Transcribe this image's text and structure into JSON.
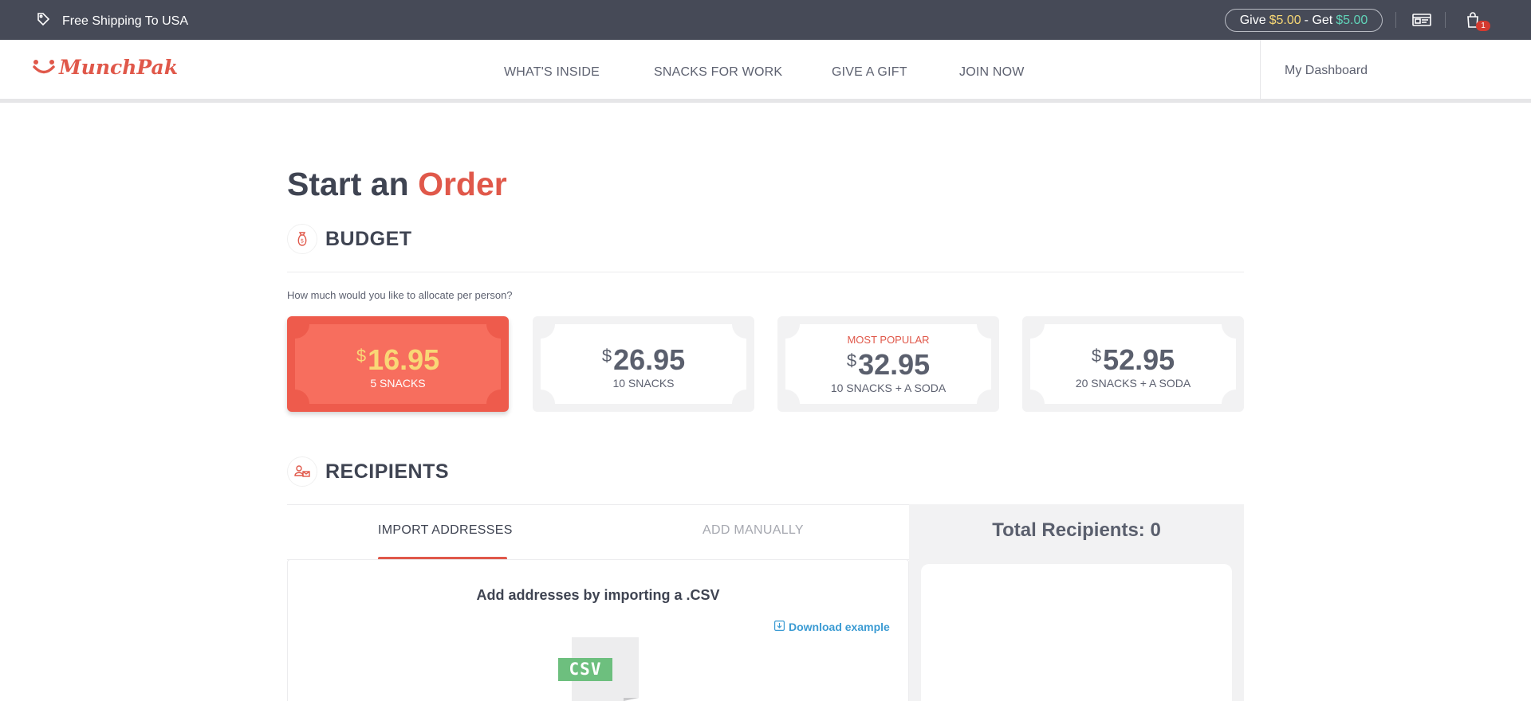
{
  "topbar": {
    "shipping_text": "Free Shipping To USA",
    "give_prefix": "Give",
    "give_amount": "$5.00",
    "get_sep": "- Get",
    "get_amount": "$5.00",
    "cart_count": "1"
  },
  "header": {
    "logo_text": "MunchPak",
    "nav": [
      "WHAT'S INSIDE",
      "SNACKS FOR WORK",
      "GIVE A GIFT",
      "JOIN NOW"
    ],
    "dashboard_label": "My Dashboard"
  },
  "main": {
    "title_part1": "Start an",
    "title_part2": "Order",
    "budget": {
      "section_title": "BUDGET",
      "question": "How much would you like to allocate per person?",
      "options": [
        {
          "currency": "$",
          "price": "16.95",
          "desc": "5 SNACKS",
          "badge": "",
          "selected": true
        },
        {
          "currency": "$",
          "price": "26.95",
          "desc": "10 SNACKS",
          "badge": "",
          "selected": false
        },
        {
          "currency": "$",
          "price": "32.95",
          "desc": "10 SNACKS + A SODA",
          "badge": "MOST POPULAR",
          "selected": false
        },
        {
          "currency": "$",
          "price": "52.95",
          "desc": "20 SNACKS + A SODA",
          "badge": "",
          "selected": false
        }
      ]
    },
    "recipients": {
      "section_title": "RECIPIENTS",
      "tabs": [
        {
          "label": "IMPORT ADDRESSES",
          "active": true
        },
        {
          "label": "ADD MANUALLY",
          "active": false
        }
      ],
      "import_title": "Add addresses by importing a .CSV",
      "download_label": "Download example",
      "csv_label": "CSV",
      "total_label": "Total Recipients: 0"
    }
  },
  "colors": {
    "topbar_bg": "#464a57",
    "accent": "#e0584a",
    "selected_card": "#ee5b4c",
    "price_highlight": "#f9d776",
    "link": "#3b9bd3",
    "csv_green": "#6dbf7e"
  },
  "icons": {
    "shipping": "tag-icon",
    "id_card": "id-card-icon",
    "cart": "shopping-bag-icon",
    "budget": "money-bag-icon",
    "recipients": "person-address-icon",
    "download": "download-icon"
  }
}
